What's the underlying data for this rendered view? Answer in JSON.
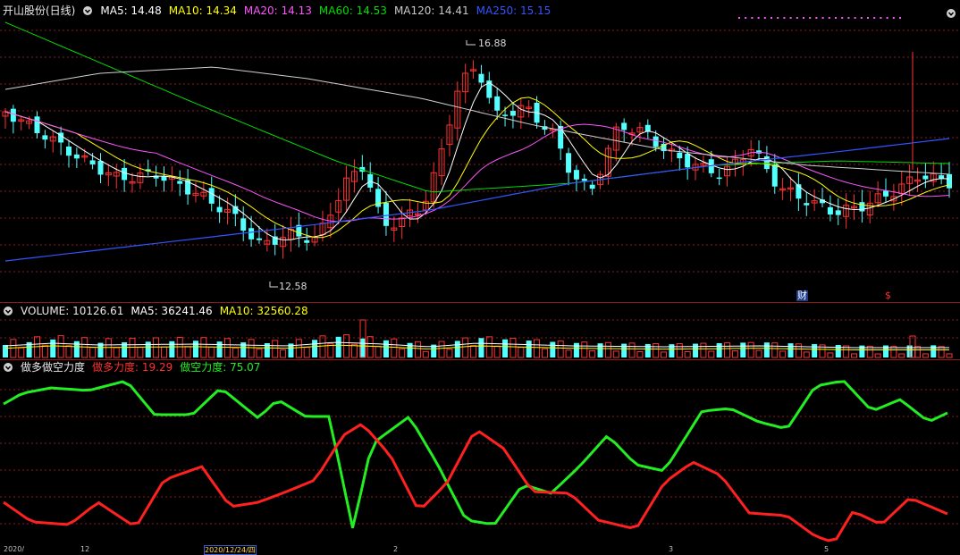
{
  "main": {
    "title": "开山股份(日线)",
    "ma": [
      {
        "label": "MA5: 14.48",
        "color": "#ffffff"
      },
      {
        "label": "MA10: 14.34",
        "color": "#ffff00"
      },
      {
        "label": "MA20: 14.13",
        "color": "#ff55ff"
      },
      {
        "label": "MA60: 14.53",
        "color": "#00dd00"
      },
      {
        "label": "MA120: 14.41",
        "color": "#c8c8c8"
      },
      {
        "label": "MA250: 15.15",
        "color": "#3355ff"
      }
    ],
    "high_label": "16.88",
    "low_label": "12.58",
    "badge_cai": "财",
    "badge_dollar": "$"
  },
  "volume": {
    "title": "VOLUME: 10126.61",
    "ma5": "MA5: 36241.46",
    "ma10": "MA10: 32560.28"
  },
  "indicator": {
    "title": "做多做空力度",
    "long_label": "做多力度: 19.29",
    "short_label": "做空力度: 75.07"
  },
  "axis_dates": [
    "2020/",
    "12",
    "2020/12/24/四",
    "2",
    "3",
    "5"
  ],
  "colors": {
    "up": "#ff3232",
    "down": "#54ffff",
    "grid": "#8b1c1c",
    "long": "#ff2020",
    "short": "#22ee22",
    "bg": "#000000"
  }
}
